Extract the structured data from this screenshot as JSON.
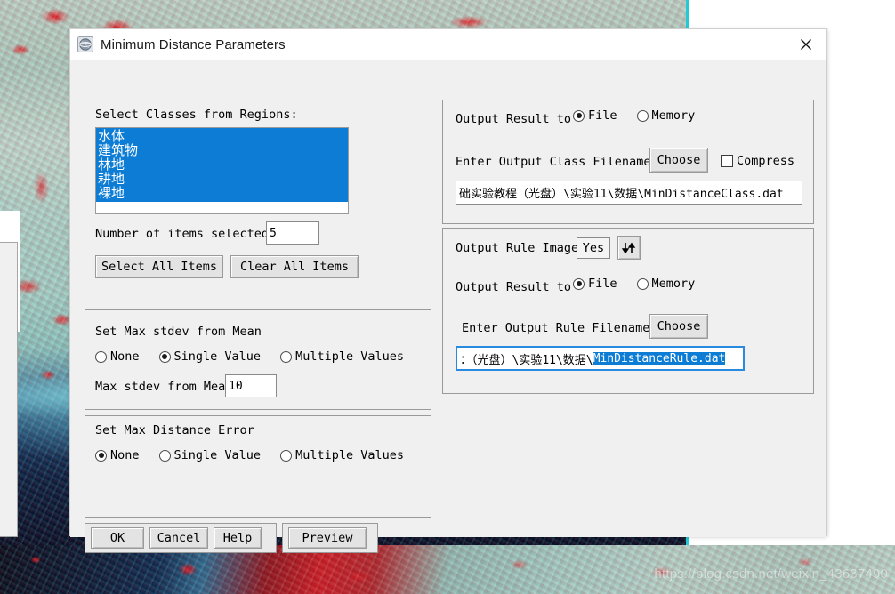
{
  "window": {
    "title": "Minimum Distance Parameters",
    "icon": "envi-globe-icon",
    "close_label": "×"
  },
  "background": {
    "watermark": "https://blog.csdn.net/weixin_43637490"
  },
  "classes_group": {
    "label": "Select Classes from Regions:",
    "items": [
      {
        "label": "水体",
        "selected": true
      },
      {
        "label": "建筑物",
        "selected": true
      },
      {
        "label": "林地",
        "selected": true
      },
      {
        "label": "耕地",
        "selected": true
      },
      {
        "label": "裸地",
        "selected": true
      }
    ],
    "count_label": "Number of items selected:",
    "count_value": "5",
    "select_all_label": "Select All Items",
    "clear_all_label": "Clear All Items"
  },
  "stdev_group": {
    "label": "Set Max stdev from Mean",
    "options": [
      {
        "label": "None",
        "selected": false
      },
      {
        "label": "Single Value",
        "selected": true
      },
      {
        "label": "Multiple Values",
        "selected": false
      }
    ],
    "value_label": "Max stdev from Mean",
    "value": "10"
  },
  "dist_error_group": {
    "label": "Set Max Distance Error",
    "options": [
      {
        "label": "None",
        "selected": true
      },
      {
        "label": "Single Value",
        "selected": false
      },
      {
        "label": "Multiple Values",
        "selected": false
      }
    ]
  },
  "output_class_group": {
    "output_result_label": "Output Result to",
    "options": [
      {
        "label": "File",
        "selected": true
      },
      {
        "label": "Memory",
        "selected": false
      }
    ],
    "filename_label": "Enter Output Class Filename",
    "choose_label": "Choose",
    "compress_label": "Compress",
    "compress_checked": false,
    "filename_value": "础实验教程（光盘）\\实验11\\数据\\MinDistanceClass.dat"
  },
  "output_rule_group": {
    "rule_images_label": "Output Rule Images ?",
    "rule_images_value": "Yes",
    "toggle_arrows_icon": "up-down-arrows-icon",
    "output_result_label": "Output Result to",
    "options": [
      {
        "label": "File",
        "selected": true
      },
      {
        "label": "Memory",
        "selected": false
      }
    ],
    "filename_label": "Enter Output Rule Filename",
    "choose_label": "Choose",
    "filename_prefix": "：（光盘）\\实验11\\数据\\",
    "filename_selected": "MinDistanceRule.dat"
  },
  "buttons": {
    "ok": "OK",
    "cancel": "Cancel",
    "help": "Help",
    "preview": "Preview"
  },
  "colors": {
    "selection_blue": "#0c7cd5",
    "dialog_face": "#f0f0f0",
    "focus_border": "#2a8ae0"
  }
}
